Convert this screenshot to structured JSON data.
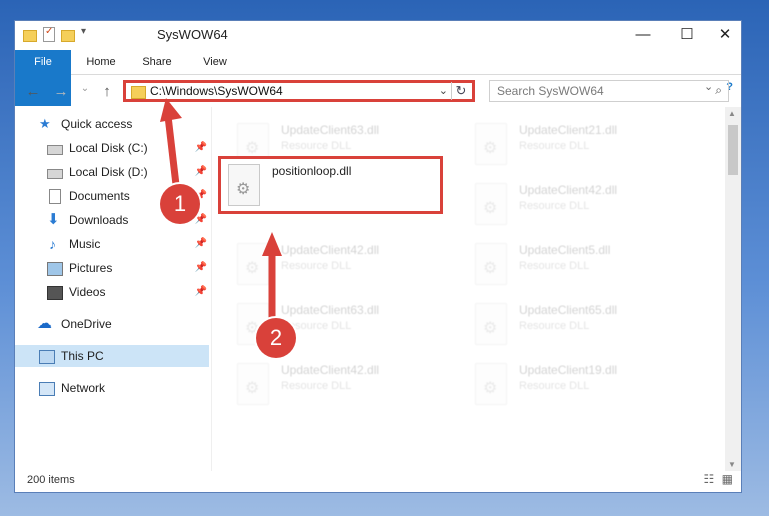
{
  "window": {
    "title": "SysWOW64",
    "minimize": "—",
    "maximize": "☐",
    "close": "✕"
  },
  "ribbon": {
    "tabs": [
      "File",
      "Home",
      "Share",
      "View"
    ],
    "collapse": "⌄",
    "help": "?"
  },
  "address": {
    "path": "C:\\Windows\\SysWOW64",
    "dropdown": "⌄",
    "refresh": "↻"
  },
  "search": {
    "placeholder": "Search SysWOW64",
    "icon": "search-icon"
  },
  "nav_pane": {
    "items": [
      {
        "label": "Quick access",
        "icon": "star-icon",
        "pinned": false
      },
      {
        "label": "Local Disk (C:)",
        "icon": "drive-icon",
        "pinned": true
      },
      {
        "label": "Local Disk (D:)",
        "icon": "drive-icon",
        "pinned": true
      },
      {
        "label": "Documents",
        "icon": "documents-icon",
        "pinned": true
      },
      {
        "label": "Downloads",
        "icon": "downloads-icon",
        "pinned": true
      },
      {
        "label": "Music",
        "icon": "music-icon",
        "pinned": true
      },
      {
        "label": "Pictures",
        "icon": "pictures-icon",
        "pinned": true
      },
      {
        "label": "Videos",
        "icon": "videos-icon",
        "pinned": true
      },
      {
        "label": "OneDrive",
        "icon": "cloud-icon",
        "pinned": false
      },
      {
        "label": "This PC",
        "icon": "computer-icon",
        "pinned": false,
        "selected": true
      },
      {
        "label": "Network",
        "icon": "network-icon",
        "pinned": false
      }
    ]
  },
  "files": {
    "highlighted": {
      "name": "positionloop.dll",
      "desc": ""
    },
    "background": [
      {
        "name": "UpdateClient63.dll",
        "desc": "Resource DLL"
      },
      {
        "name": "UpdateClient21.dll",
        "desc": "Resource DLL"
      },
      {
        "name": "UpdateClient42.dll",
        "desc": "Resource DLL"
      },
      {
        "name": "UpdateClient42.dll",
        "desc": "Resource DLL"
      },
      {
        "name": "UpdateClient5.dll",
        "desc": "Resource DLL"
      },
      {
        "name": "UpdateClient63.dll",
        "desc": "Resource DLL"
      },
      {
        "name": "UpdateClient65.dll",
        "desc": "Resource DLL"
      },
      {
        "name": "UpdateClient42.dll",
        "desc": "Resource DLL"
      },
      {
        "name": "UpdateClient19.dll",
        "desc": "Resource DLL"
      }
    ]
  },
  "annotations": {
    "step1": "1",
    "step2": "2",
    "color": "#d9413a"
  },
  "status": {
    "item_count": "200 items"
  }
}
